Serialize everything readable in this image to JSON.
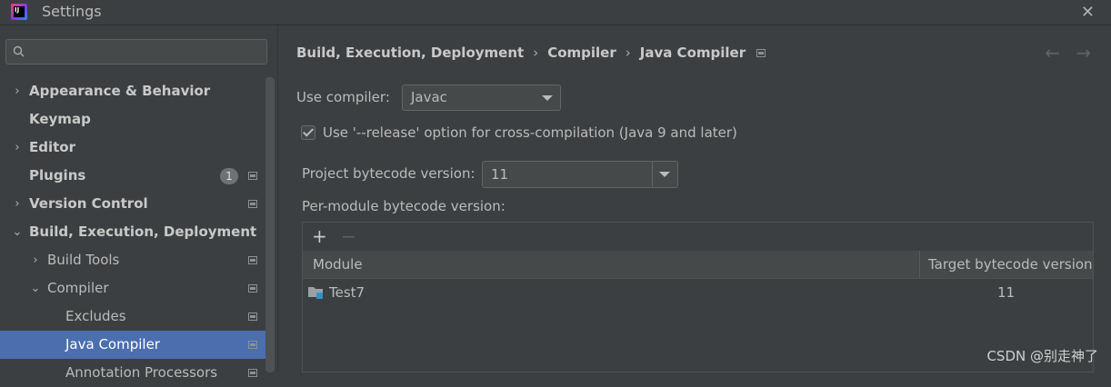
{
  "window": {
    "title": "Settings",
    "close_glyph": "✕"
  },
  "search": {
    "placeholder": ""
  },
  "sidebar": {
    "items": [
      {
        "label": "Appearance & Behavior",
        "chevron": "›"
      },
      {
        "label": "Keymap"
      },
      {
        "label": "Editor",
        "chevron": "›"
      },
      {
        "label": "Plugins",
        "badge": "1"
      },
      {
        "label": "Version Control",
        "chevron": "›"
      },
      {
        "label": "Build, Execution, Deployment",
        "chevron": "⌄"
      },
      {
        "label": "Build Tools",
        "chevron": "›"
      },
      {
        "label": "Compiler",
        "chevron": "⌄"
      },
      {
        "label": "Excludes"
      },
      {
        "label": "Java Compiler",
        "selected": true
      },
      {
        "label": "Annotation Processors"
      }
    ]
  },
  "breadcrumb": {
    "items": [
      "Build, Execution, Deployment",
      "Compiler",
      "Java Compiler"
    ],
    "separator": "›"
  },
  "nav": {
    "back": "←",
    "forward": "→"
  },
  "form": {
    "use_compiler_label": "Use compiler:",
    "use_compiler_value": "Javac",
    "release_option_label": "Use '--release' option for cross-compilation (Java 9 and later)",
    "release_option_checked": true,
    "project_bytecode_label": "Project bytecode version:",
    "project_bytecode_value": "11",
    "per_module_label": "Per-module bytecode version:"
  },
  "table": {
    "add_glyph": "+",
    "remove_glyph": "−",
    "columns": [
      "Module",
      "Target bytecode version"
    ],
    "rows": [
      {
        "module": "Test7",
        "target": "11"
      }
    ]
  },
  "watermark": "CSDN @别走神了",
  "colors": {
    "background": "#3c3f41",
    "selection": "#4b6eaf",
    "module_icon": "#3592c4"
  }
}
